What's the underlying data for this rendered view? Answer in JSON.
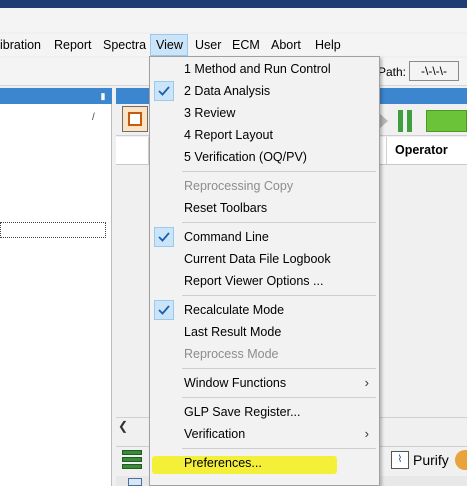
{
  "menubar": {
    "items": [
      "ibration",
      "Report",
      "Spectra",
      "View",
      "User",
      "ECM",
      "Abort",
      "Help"
    ],
    "active": "View"
  },
  "toolbar": {
    "path_label": "Path:",
    "path_value": "-\\-\\-\\-"
  },
  "left_pane": {
    "marker": "/"
  },
  "table": {
    "operator_header": "Operator"
  },
  "bottom_toolbar": {
    "purify_label": "Purify"
  },
  "view_menu": {
    "items": [
      {
        "label": "1 Method and Run Control",
        "checked": false,
        "disabled": false
      },
      {
        "label": "2 Data Analysis",
        "checked": true,
        "disabled": false
      },
      {
        "label": "3 Review",
        "checked": false,
        "disabled": false
      },
      {
        "label": "4 Report Layout",
        "checked": false,
        "disabled": false
      },
      {
        "label": "5 Verification (OQ/PV)",
        "checked": false,
        "disabled": false
      },
      {
        "label": "Reprocessing Copy",
        "checked": false,
        "disabled": true
      },
      {
        "label": "Reset Toolbars",
        "checked": false,
        "disabled": false
      },
      {
        "label": "Command Line",
        "checked": true,
        "disabled": false
      },
      {
        "label": "Current Data File Logbook",
        "checked": false,
        "disabled": false
      },
      {
        "label": "Report Viewer Options ...",
        "checked": false,
        "disabled": false
      },
      {
        "label": "Recalculate Mode",
        "checked": true,
        "disabled": false
      },
      {
        "label": "Last Result Mode",
        "checked": false,
        "disabled": false
      },
      {
        "label": "Reprocess Mode",
        "checked": false,
        "disabled": true
      },
      {
        "label": "Window Functions",
        "checked": false,
        "disabled": false,
        "submenu": true
      },
      {
        "label": "GLP Save Register...",
        "checked": false,
        "disabled": false
      },
      {
        "label": "Verification",
        "checked": false,
        "disabled": false,
        "submenu": true
      },
      {
        "label": "Preferences...",
        "checked": false,
        "disabled": false,
        "highlighted": true
      }
    ]
  },
  "colors": {
    "accent": "#3c86cf",
    "check_bg": "#cce4f7",
    "highlight": "#f4f01a",
    "green": "#6ac339"
  },
  "icons": [
    "pin-icon",
    "checkmark-icon",
    "submenu-arrow-icon",
    "play-icon",
    "pause-icon",
    "purify-icon",
    "database-icon"
  ]
}
